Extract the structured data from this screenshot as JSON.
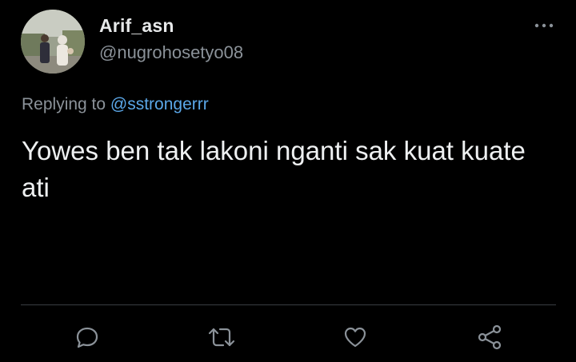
{
  "author": {
    "display_name": "Arif_asn",
    "handle": "@nugrohosetyo08"
  },
  "reply": {
    "prefix": "Replying to",
    "mention": "@sstrongerrr"
  },
  "tweet": {
    "text": "Yowes ben tak lakoni nganti sak kuat kuate ati"
  },
  "icons": {
    "more": "more-dots-icon",
    "reply": "reply-bubble-icon",
    "retweet": "retweet-icon",
    "like": "heart-icon",
    "share": "share-icon"
  },
  "colors": {
    "background": "#000000",
    "text_primary": "#e7e9ea",
    "text_secondary": "#8b9299",
    "link": "#5ba7e8",
    "divider": "#3a3e42"
  }
}
